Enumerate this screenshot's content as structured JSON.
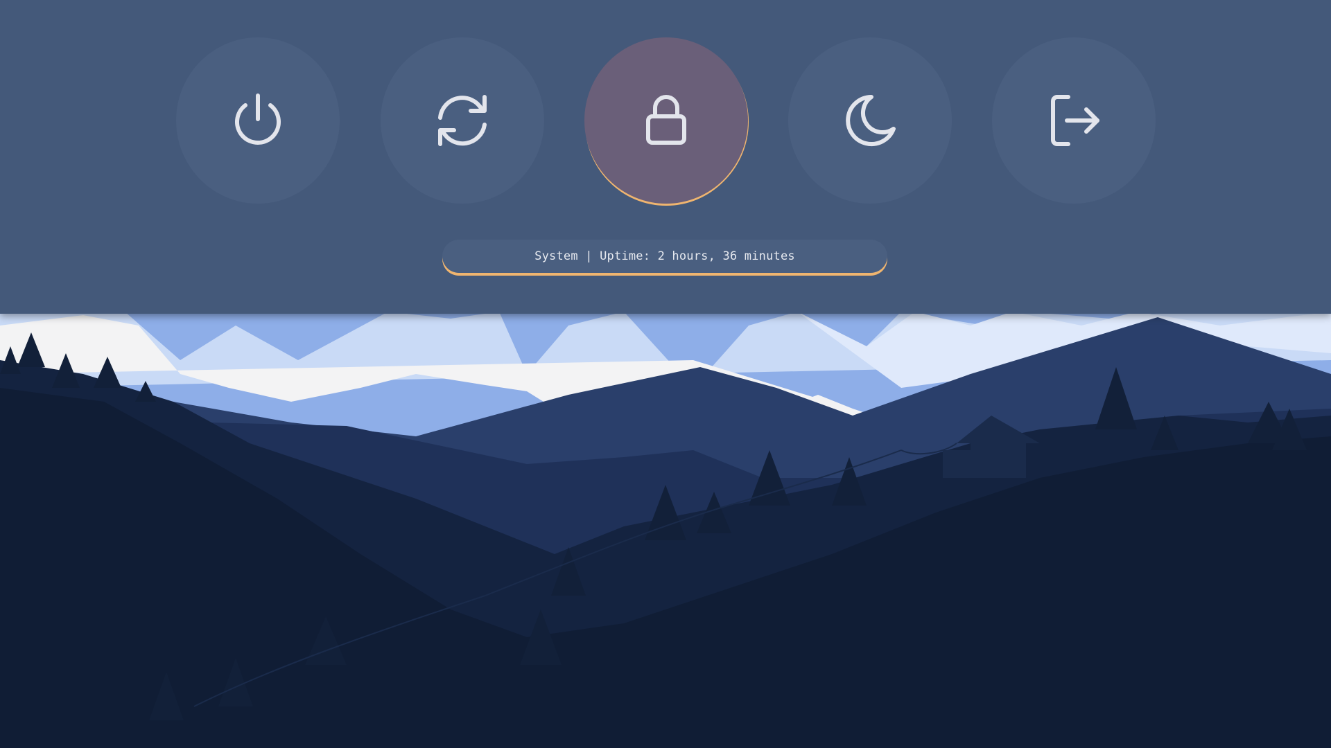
{
  "colors": {
    "panel": "#44597a",
    "button": "#4a5f80",
    "button_selected": "#6a5f79",
    "accent": "#f0b56f",
    "icon": "#e3e5ec"
  },
  "buttons": [
    {
      "icon": "power-icon",
      "selected": false
    },
    {
      "icon": "reboot-icon",
      "selected": false
    },
    {
      "icon": "lock-icon",
      "selected": true
    },
    {
      "icon": "suspend-moon-icon",
      "selected": false
    },
    {
      "icon": "logout-icon",
      "selected": false
    }
  ],
  "status": {
    "text": "System | Uptime: 2 hours, 36 minutes"
  }
}
